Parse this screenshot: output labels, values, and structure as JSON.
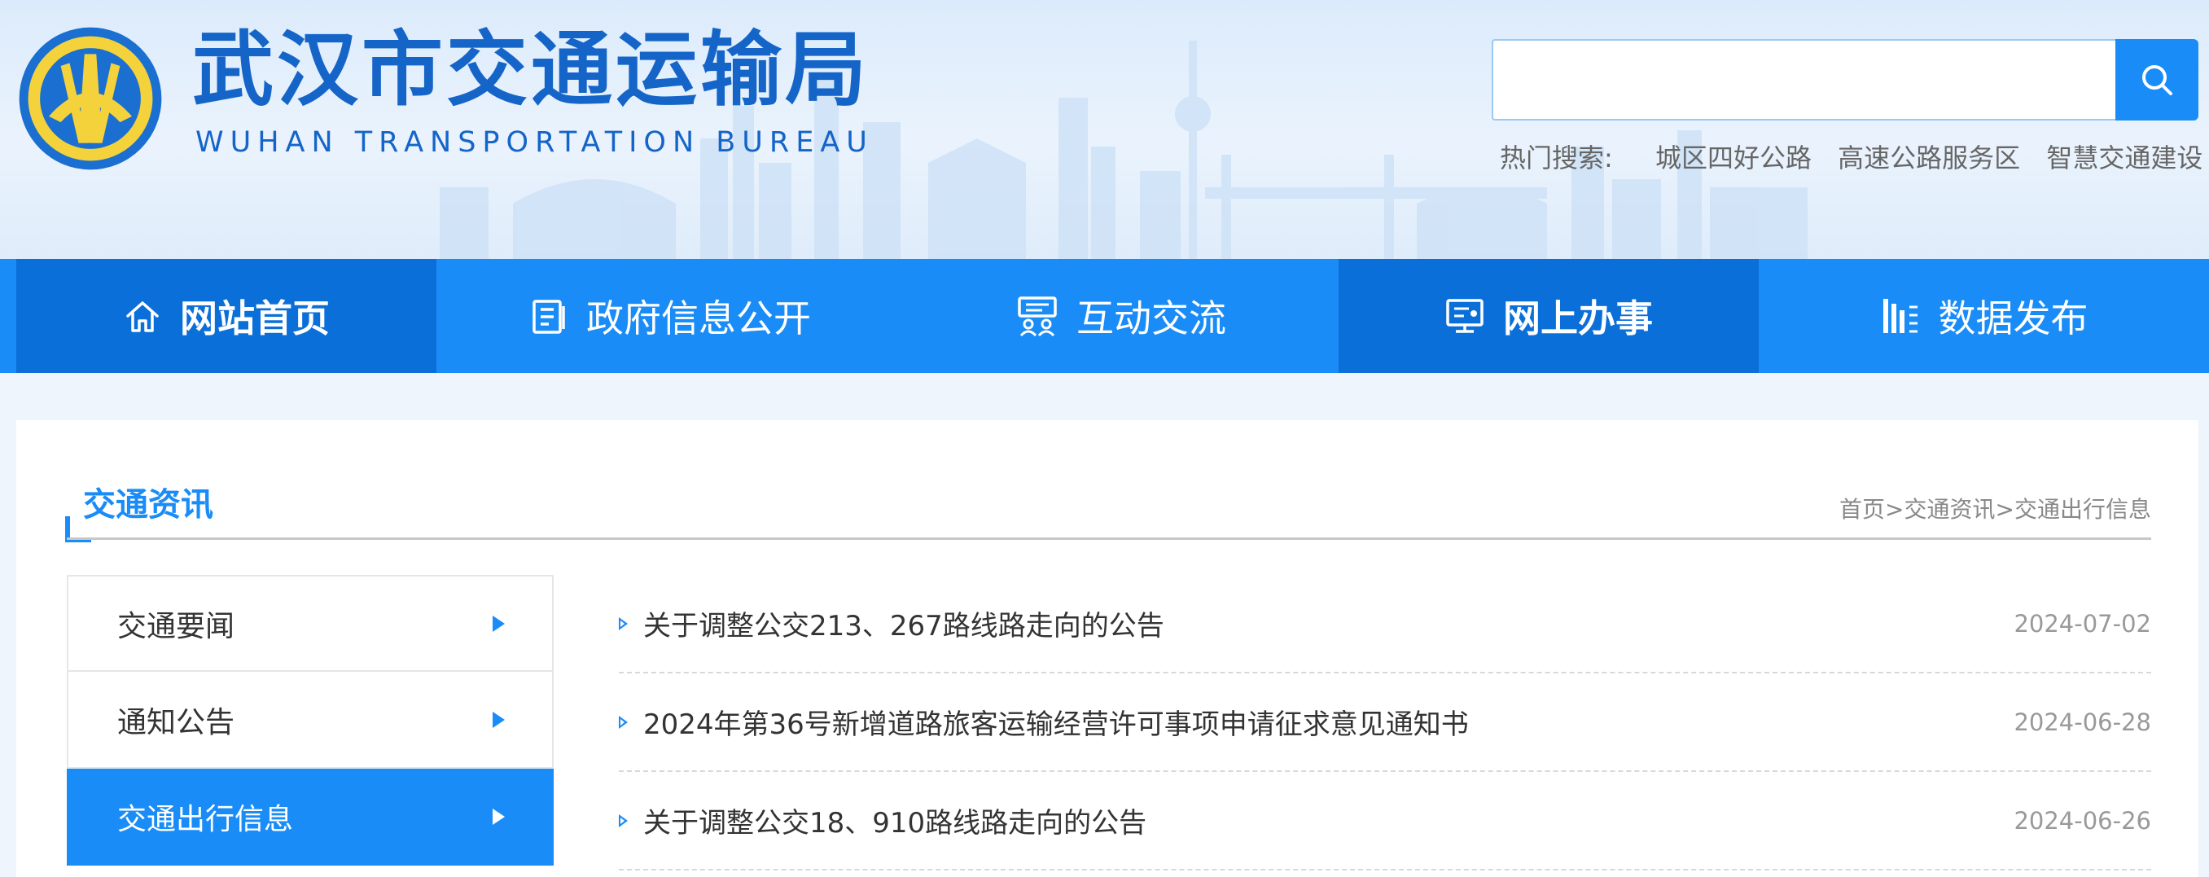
{
  "header": {
    "title": "武汉市交通运输局",
    "subtitle": "WUHAN TRANSPORTATION BUREAU"
  },
  "search": {
    "placeholder": "",
    "hot_label": "热门搜索:",
    "hot_terms": [
      "城区四好公路",
      "高速公路服务区",
      "智慧交通建设"
    ]
  },
  "nav": {
    "items": [
      {
        "label": "网站首页",
        "icon": "home-icon"
      },
      {
        "label": "政府信息公开",
        "icon": "document-icon"
      },
      {
        "label": "互动交流",
        "icon": "chat-icon"
      },
      {
        "label": "网上办事",
        "icon": "monitor-icon"
      },
      {
        "label": "数据发布",
        "icon": "data-icon"
      }
    ]
  },
  "section": {
    "title": "交通资讯",
    "breadcrumb": [
      "首页",
      ">",
      "交通资讯",
      ">",
      "交通出行信息"
    ]
  },
  "sidebar": {
    "items": [
      {
        "label": "交通要闻"
      },
      {
        "label": "通知公告"
      },
      {
        "label": "交通出行信息"
      }
    ]
  },
  "news": [
    {
      "title": "关于调整公交213、267路线路走向的公告",
      "date": "2024-07-02"
    },
    {
      "title": "2024年第36号新增道路旅客运输经营许可事项申请征求意见通知书",
      "date": "2024-06-28"
    },
    {
      "title": "关于调整公交18、910路线路走向的公告",
      "date": "2024-06-26"
    }
  ],
  "colors": {
    "primary": "#1a8cf7",
    "primary_dark": "#0b6fd9",
    "brand_text": "#1565c8",
    "logo_yellow": "#f4d23c"
  }
}
